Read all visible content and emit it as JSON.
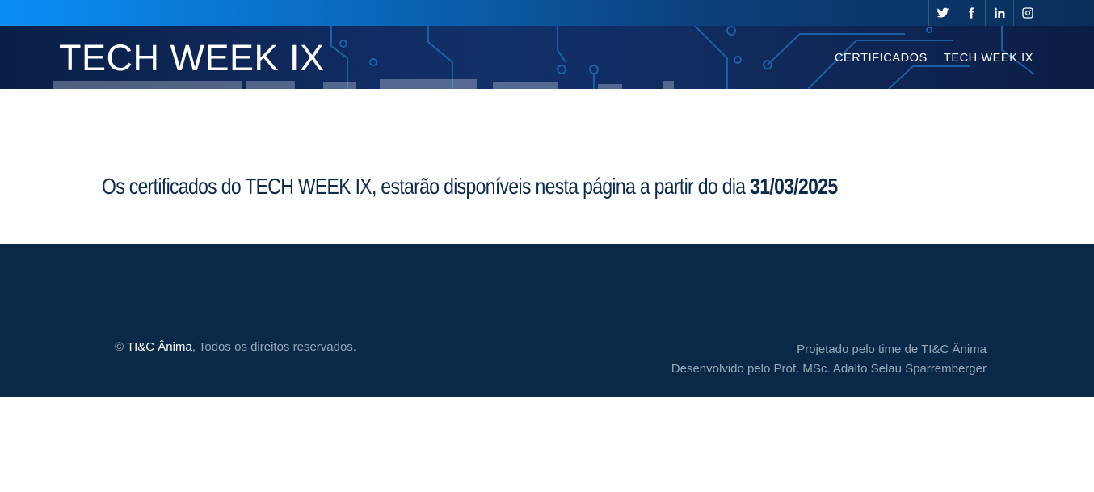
{
  "social": {
    "items": [
      {
        "name": "twitter-icon",
        "label": "Twitter"
      },
      {
        "name": "facebook-icon",
        "label": "Facebook"
      },
      {
        "name": "linkedin-icon",
        "label": "LinkedIn"
      },
      {
        "name": "instagram-icon",
        "label": "Instagram"
      }
    ]
  },
  "header": {
    "brand": "TECH WEEK IX",
    "nav": [
      "CERTIFICADOS",
      "TECH WEEK IX"
    ]
  },
  "main": {
    "message_prefix": "Os certificados do TECH WEEK IX, estarão disponíveis nesta página a partir do dia ",
    "date": "31/03/2025"
  },
  "footer": {
    "copyright_symbol": "© ",
    "owner": "TI&C Ânima",
    "rights": ", Todos os direitos reservados.",
    "designed_by": "Projetado pelo time de TI&C Ânima",
    "developed_by": "Desenvolvido pelo Prof. MSc. Adalto Selau Sparremberger"
  },
  "colors": {
    "footer_bg": "#0a2948",
    "message_text": "#0b2b4c",
    "header_bg": "#12306a"
  }
}
